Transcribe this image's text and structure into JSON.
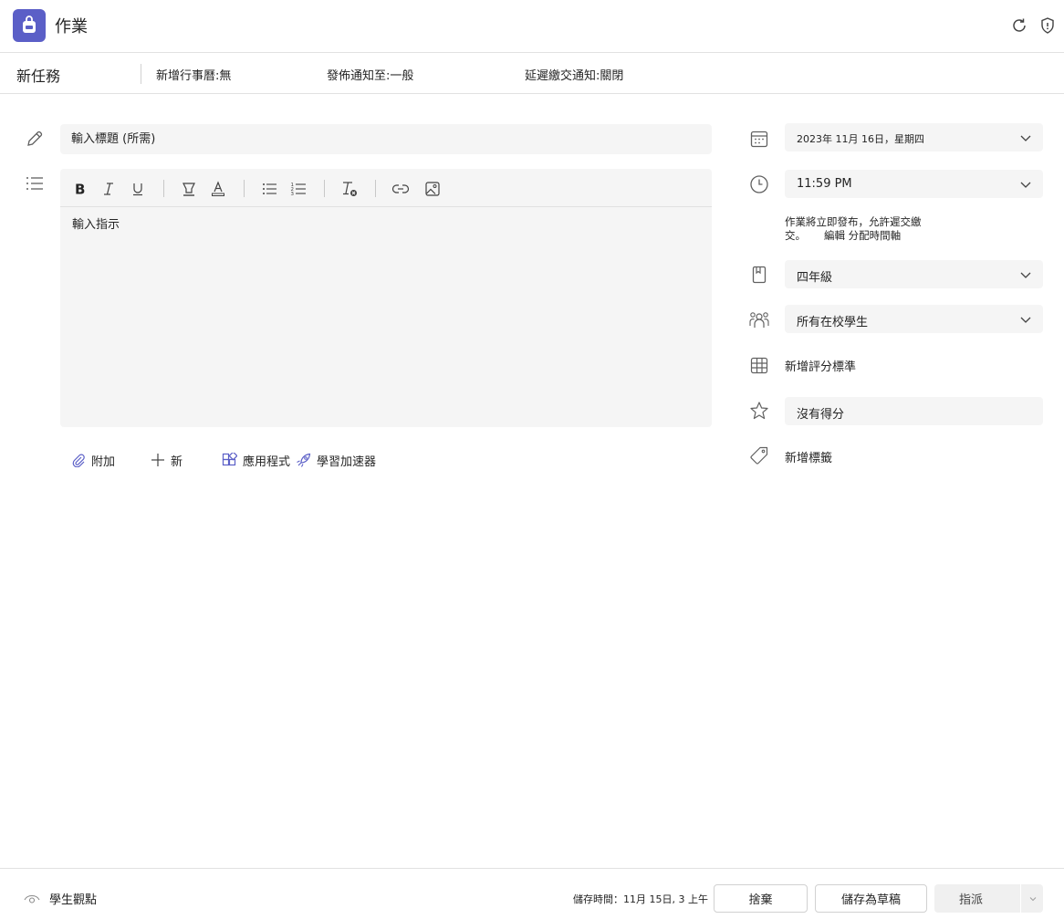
{
  "header": {
    "app_title": "作業",
    "logo_icon": "backpack-icon",
    "refresh_icon": "refresh-icon",
    "shield_icon": "shield-icon",
    "accent_color": "#5b5fc7"
  },
  "subheader": {
    "title": "新任務",
    "calendar_link": "新增行事曆:無",
    "notify_link": "發佈通知至:一般",
    "late_notify_link": "延遲繳交通知:關閉"
  },
  "form": {
    "title_placeholder": "輸入標題 (所需)",
    "instructions_placeholder": "輸入指示",
    "toolbar": [
      "bold",
      "italic",
      "underline",
      "highlight",
      "font-color",
      "bulleted-list",
      "numbered-list",
      "clear-format",
      "link",
      "image"
    ],
    "attach_label": "附加",
    "new_label": "新",
    "apps_label": "應用程式",
    "accelerator_label": "學習加速器"
  },
  "settings": {
    "due_date": "2023年 11月 16日，星期四",
    "due_time": "11:59 PM",
    "note_text": "作業將立即發布，允許遲交繳交。",
    "edit_timeline_link": "編輯 分配時間軸",
    "grade_level": "四年級",
    "students": "所有在校學生",
    "add_rubric": "新增評分標準",
    "points": "沒有得分",
    "add_tag": "新增標籤"
  },
  "footer": {
    "student_view": "學生觀點",
    "saved_text": "儲存時間：11月 15日, 3 上午",
    "discard_label": "捨棄",
    "save_draft_label": "儲存為草稿",
    "assign_label": "指派"
  }
}
